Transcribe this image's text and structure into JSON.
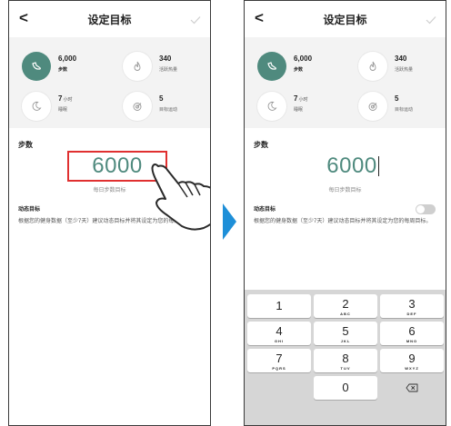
{
  "screen": {
    "title": "设定目标",
    "back_glyph": "<",
    "accent_color": "#4f8a7e",
    "highlight_color": "#e03030",
    "arrow_color": "#1e8fd8"
  },
  "goals": [
    {
      "icon": "shoe-icon",
      "value": "6,000",
      "unit": "",
      "label": "步数"
    },
    {
      "icon": "flame-icon",
      "value": "340",
      "unit": "",
      "label": "活跃热量"
    },
    {
      "icon": "moon-icon",
      "value": "7",
      "unit": "小时",
      "label": "睡眠"
    },
    {
      "icon": "target-icon",
      "value": "5",
      "unit": "",
      "label": "目标运动"
    }
  ],
  "steps": {
    "section_label": "步数",
    "value": "6000",
    "hint": "每日步数目标"
  },
  "dynamic_goal": {
    "title": "动态目标",
    "description": "根据您的健身数据（至少7天）建议动态目标并将其设定为您的每周目标。",
    "enabled": false
  },
  "keypad": {
    "keys": [
      {
        "num": "1",
        "letters": ""
      },
      {
        "num": "2",
        "letters": "ABC"
      },
      {
        "num": "3",
        "letters": "DEF"
      },
      {
        "num": "4",
        "letters": "GHI"
      },
      {
        "num": "5",
        "letters": "JKL"
      },
      {
        "num": "6",
        "letters": "MNO"
      },
      {
        "num": "7",
        "letters": "PQRS"
      },
      {
        "num": "8",
        "letters": "TUV"
      },
      {
        "num": "9",
        "letters": "WXYZ"
      },
      {
        "num": "0",
        "letters": ""
      }
    ],
    "delete_icon": "backspace-icon"
  }
}
